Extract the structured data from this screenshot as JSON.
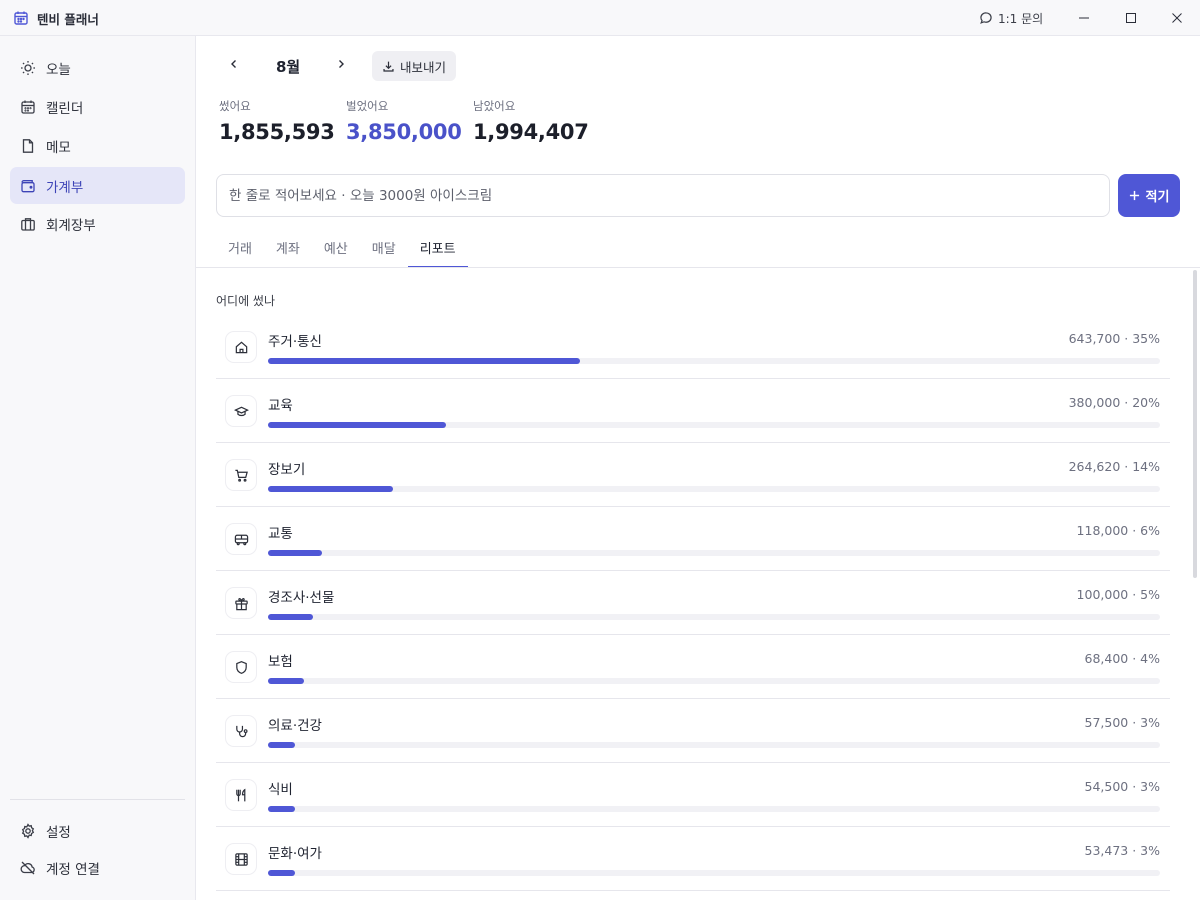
{
  "titlebar": {
    "app_title": "텐비 플래너",
    "inquiry_label": "1:1 문의",
    "app_icon": "calendar-icon"
  },
  "sidebar": {
    "items": [
      {
        "label": "오늘",
        "icon": "sun-icon"
      },
      {
        "label": "캘린더",
        "icon": "calendar-icon"
      },
      {
        "label": "메모",
        "icon": "note-icon"
      },
      {
        "label": "가계부",
        "icon": "wallet-icon",
        "active": true
      },
      {
        "label": "회계장부",
        "icon": "briefcase-icon"
      }
    ],
    "bottom": [
      {
        "label": "설정",
        "icon": "gear-icon"
      },
      {
        "label": "계정 연결",
        "icon": "cloud-off-icon"
      }
    ]
  },
  "month": {
    "label": "8월",
    "export_label": "내보내기"
  },
  "stats": {
    "spent_label": "썼어요",
    "spent_value": "1,855,593",
    "earned_label": "벌었어요",
    "earned_value": "3,850,000",
    "left_label": "남았어요",
    "left_value": "1,994,407"
  },
  "quick_entry": {
    "placeholder": "한 줄로 적어보세요 · 오늘 3000원 아이스크림",
    "value": "",
    "button_label": "적기"
  },
  "tabs": [
    "거래",
    "계좌",
    "예산",
    "매달",
    "리포트"
  ],
  "active_tab": "리포트",
  "report": {
    "section_title": "어디에 썼나",
    "categories": [
      {
        "name": "주거·통신",
        "amount": "643,700 · 35%",
        "share": 0.35,
        "icon": "home-icon"
      },
      {
        "name": "교육",
        "amount": "380,000 · 20%",
        "share": 0.2,
        "icon": "graduation-cap-icon"
      },
      {
        "name": "장보기",
        "amount": "264,620 · 14%",
        "share": 0.14,
        "icon": "cart-icon"
      },
      {
        "name": "교통",
        "amount": "118,000 · 6%",
        "share": 0.06,
        "icon": "bus-icon"
      },
      {
        "name": "경조사·선물",
        "amount": "100,000 · 5%",
        "share": 0.05,
        "icon": "gift-icon"
      },
      {
        "name": "보험",
        "amount": "68,400 · 4%",
        "share": 0.04,
        "icon": "shield-icon"
      },
      {
        "name": "의료·건강",
        "amount": "57,500 · 3%",
        "share": 0.03,
        "icon": "stethoscope-icon"
      },
      {
        "name": "식비",
        "amount": "54,500 · 3%",
        "share": 0.03,
        "icon": "utensils-icon"
      },
      {
        "name": "문화·여가",
        "amount": "53,473 · 3%",
        "share": 0.03,
        "icon": "film-icon"
      }
    ]
  },
  "colors": {
    "accent": "#4f57d6",
    "earned": "#4a52c9",
    "active_nav_bg": "#e5e6f8"
  }
}
